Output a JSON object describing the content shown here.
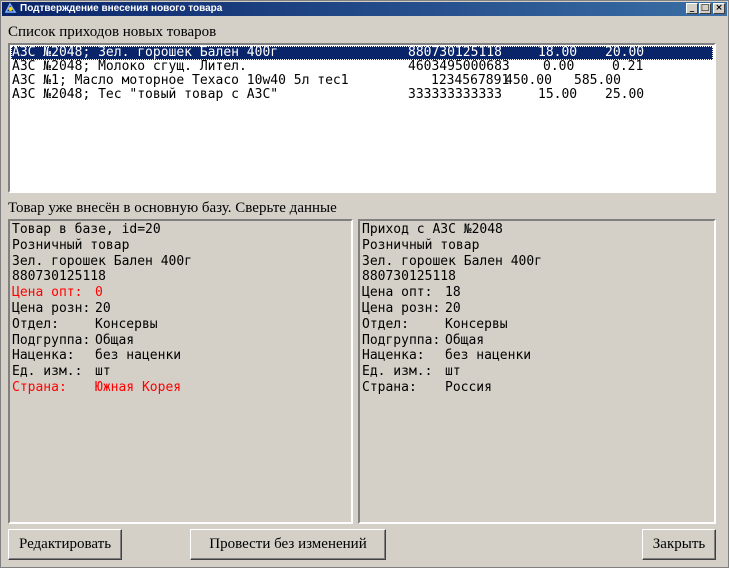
{
  "window": {
    "title": "Подтверждение внесения нового товара",
    "controls": {
      "minimize": "_",
      "maximize": "□",
      "close": "×"
    }
  },
  "list_label": "Список приходов новых товаров",
  "list_rows": [
    {
      "name": "АЗС №2048; Зел. горошек Бален 400г",
      "code": "880730125118",
      "price_opt": "18.00",
      "price_retail": "20.00",
      "selected": true
    },
    {
      "name": "АЗС №2048; Молоко сгущ. Лител.",
      "code": "4603495000683",
      "price_opt": "0.00",
      "price_retail": "0.21",
      "selected": false
    },
    {
      "name": "АЗС №1; Масло моторное Техасо 10w40 5л тес1",
      "code": "1234567891",
      "price_opt": "450.00",
      "price_retail": "585.00",
      "selected": false
    },
    {
      "name": "АЗС №2048; Тес \"товый товар с АЗС\"",
      "code": "333333333333",
      "price_opt": "15.00",
      "price_retail": "25.00",
      "selected": false
    }
  ],
  "compare_label": "Товар уже внесён в основную базу. Сверьте данные",
  "left_panel": {
    "header": "Товар в базе, id=20",
    "kind": "Розничный товар",
    "product": "Зел. горошек Бален 400г",
    "code": "880730125118",
    "fields": [
      {
        "label": "Цена опт:",
        "value": "0",
        "highlight": true
      },
      {
        "label": "Цена розн:",
        "value": "20",
        "highlight": false
      },
      {
        "label": "Отдел:",
        "value": "Консервы",
        "highlight": false
      },
      {
        "label": "Подгруппа:",
        "value": "Общая",
        "highlight": false
      },
      {
        "label": "Наценка:",
        "value": "без наценки",
        "highlight": false
      },
      {
        "label": "Ед. изм.:",
        "value": "шт",
        "highlight": false
      },
      {
        "label": "Страна:",
        "value": "Южная Корея",
        "highlight": true
      }
    ]
  },
  "right_panel": {
    "header": "Приход с АЗС №2048",
    "kind": "Розничный товар",
    "product": "Зел. горошек Бален 400г",
    "code": "880730125118",
    "fields": [
      {
        "label": "Цена опт:",
        "value": "18",
        "highlight": false
      },
      {
        "label": "Цена розн:",
        "value": "20",
        "highlight": false
      },
      {
        "label": "Отдел:",
        "value": "Консервы",
        "highlight": false
      },
      {
        "label": "Подгруппа:",
        "value": "Общая",
        "highlight": false
      },
      {
        "label": "Наценка:",
        "value": "без наценки",
        "highlight": false
      },
      {
        "label": "Ед. изм.:",
        "value": "шт",
        "highlight": false
      },
      {
        "label": "Страна:",
        "value": "Россия",
        "highlight": false
      }
    ]
  },
  "buttons": {
    "edit": "Редактировать",
    "apply": "Провести без изменений",
    "close": "Закрыть"
  },
  "colors": {
    "selection": "#0a246a",
    "highlight": "#ff0000",
    "face": "#d4d0c8"
  }
}
